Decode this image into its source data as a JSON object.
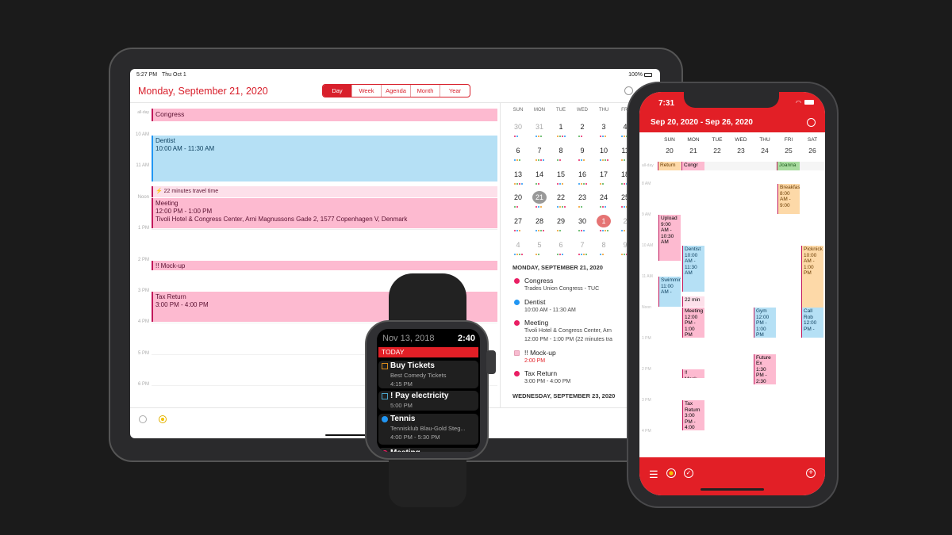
{
  "ipad": {
    "status_time": "5:27 PM",
    "status_date": "Thu Oct 1",
    "battery": "100%",
    "title": "Monday, September 21, 2020",
    "views": [
      "Day",
      "Week",
      "Agenda",
      "Month",
      "Year"
    ],
    "active_view": "Day",
    "all_day_label": "all-day",
    "all_day_event": "Congress",
    "hours": [
      "10 AM",
      "11 AM",
      "Noon",
      "1 PM",
      "2 PM",
      "3 PM",
      "4 PM",
      "5 PM",
      "6 PM"
    ],
    "events": [
      {
        "title": "Dentist",
        "time": "10:00 AM - 11:30 AM",
        "start": 10,
        "end": 11.5,
        "color": "blue"
      },
      {
        "title": "22 minutes travel time",
        "start": 11.63,
        "end": 12,
        "color": "light",
        "travel": true
      },
      {
        "title": "Meeting",
        "time": "12:00 PM - 1:00 PM",
        "location": "Tivoli Hotel & Congress Center, Arni Magnussons Gade 2, 1577 Copenhagen V, Denmark",
        "start": 12,
        "end": 13,
        "color": "pink"
      },
      {
        "title": "!! Mock-up",
        "start": 14,
        "end": 14.35,
        "color": "pink"
      },
      {
        "title": "Tax Return",
        "time": "3:00 PM - 4:00 PM",
        "start": 15,
        "end": 16,
        "color": "pink"
      }
    ],
    "month": {
      "weekdays": [
        "SUN",
        "MON",
        "TUE",
        "WED",
        "THU",
        "FRI",
        "SAT"
      ],
      "weeks": [
        [
          "30",
          "31",
          "1",
          "2",
          "3",
          "4",
          "5"
        ],
        [
          "6",
          "7",
          "8",
          "9",
          "10",
          "11",
          "12"
        ],
        [
          "13",
          "14",
          "15",
          "16",
          "17",
          "18",
          "19"
        ],
        [
          "20",
          "21",
          "22",
          "23",
          "24",
          "25",
          "26"
        ],
        [
          "27",
          "28",
          "29",
          "30",
          "1",
          "2",
          "3"
        ],
        [
          "4",
          "5",
          "6",
          "7",
          "8",
          "9",
          "10"
        ]
      ],
      "selected": "21",
      "today": "1"
    },
    "agenda": {
      "day1": "MONDAY, SEPTEMBER 21, 2020",
      "items": [
        {
          "title": "Congress",
          "sub": "Trades Union Congress - TUC",
          "color": "#e91e63"
        },
        {
          "title": "Dentist",
          "sub": "10:00 AM - 11:30 AM",
          "color": "#2196f3"
        },
        {
          "title": "Meeting",
          "sub": "Tivoli Hotel & Congress Center, Arn",
          "sub2": "12:00 PM - 1:00 PM (22 minutes tra",
          "color": "#e91e63"
        },
        {
          "title": "!! Mock-up",
          "sub": "2:00 PM",
          "color": "#f8bbd0",
          "task": true
        },
        {
          "title": "Tax Return",
          "sub": "3:00 PM - 4:00 PM",
          "color": "#e91e63"
        }
      ],
      "day2": "WEDNESDAY, SEPTEMBER 23, 2020"
    }
  },
  "iphone": {
    "time": "7:31",
    "title": "Sep 20, 2020 - Sep 26, 2020",
    "days": [
      {
        "d": "SUN",
        "n": "20"
      },
      {
        "d": "MON",
        "n": "21"
      },
      {
        "d": "TUE",
        "n": "22"
      },
      {
        "d": "WED",
        "n": "23"
      },
      {
        "d": "THU",
        "n": "24"
      },
      {
        "d": "FRI",
        "n": "25"
      },
      {
        "d": "SAT",
        "n": "26"
      }
    ],
    "all_day_label": "all-day",
    "all_day": [
      {
        "title": "Return",
        "day": 0,
        "color": "orange"
      },
      {
        "title": "Congr",
        "day": 1,
        "color": "pink"
      },
      {
        "title": "Joanna",
        "day": 5,
        "color": "green"
      }
    ],
    "hours": [
      "8 AM",
      "9 AM",
      "10 AM",
      "11 AM",
      "Noon",
      "1 PM",
      "2 PM",
      "3 PM",
      "4 PM"
    ],
    "events": [
      {
        "title": "Breakfast",
        "time": "8:00 AM - 9:00",
        "day": 5,
        "start": 8,
        "end": 9,
        "color": "orange"
      },
      {
        "title": "Upload",
        "time": "9:00 AM - 10:30 AM",
        "day": 0,
        "start": 9,
        "end": 10.5,
        "color": "pink"
      },
      {
        "title": "Dentist",
        "time": "10:00 AM - 11:30 AM",
        "day": 1,
        "start": 10,
        "end": 11.5,
        "color": "blue"
      },
      {
        "title": "Picknick",
        "time": "10:00 AM - 1:00 PM",
        "day": 6,
        "start": 10,
        "end": 13,
        "color": "orange"
      },
      {
        "title": "Swimming",
        "time": "11:00 AM -",
        "day": 0,
        "start": 11,
        "end": 12,
        "color": "blue"
      },
      {
        "title": "22 min",
        "time": "",
        "day": 1,
        "start": 11.63,
        "end": 12,
        "color": "light"
      },
      {
        "title": "Meeting",
        "time": "12:00 PM - 1:00 PM",
        "day": 1,
        "start": 12,
        "end": 13,
        "color": "pink"
      },
      {
        "title": "Gym",
        "time": "12:00 PM - 1:00 PM",
        "day": 4,
        "start": 12,
        "end": 13,
        "color": "blue"
      },
      {
        "title": "Call Rob",
        "time": "12:00 PM -",
        "day": 6,
        "start": 12,
        "end": 13,
        "color": "blue"
      },
      {
        "title": "Future Ex",
        "time": "1:30 PM - 2:30",
        "day": 4,
        "start": 13.5,
        "end": 14.5,
        "color": "pink"
      },
      {
        "title": "!! Mock-",
        "time": "",
        "day": 1,
        "start": 14,
        "end": 14.3,
        "color": "pink"
      },
      {
        "title": "Tax Return",
        "time": "3:00 PM - 4:00",
        "day": 1,
        "start": 15,
        "end": 16,
        "color": "pink"
      }
    ]
  },
  "watch": {
    "date": "Nov 13, 2018",
    "time": "2:40",
    "section": "TODAY",
    "items": [
      {
        "title": "Buy Tickets",
        "sub": "Best Comedy Tickets",
        "time": "4:15 PM",
        "marker": "#d98a1a",
        "task": true
      },
      {
        "title": "! Pay electricity",
        "time": "5:00 PM",
        "marker": "#4aa3c8",
        "task": true
      },
      {
        "title": "Tennis",
        "sub": "Tennisklub Blau-Gold Steg...",
        "time": "4:00 PM - 5:30 PM",
        "marker": "#2196f3"
      },
      {
        "title": "Meeting",
        "marker": "#e91e63"
      }
    ]
  },
  "colors": {
    "accent": "#e21f26",
    "pink": "#fdbad0",
    "blue": "#b5e0f5",
    "orange": "#fdd9a8",
    "green": "#a9dca0"
  }
}
